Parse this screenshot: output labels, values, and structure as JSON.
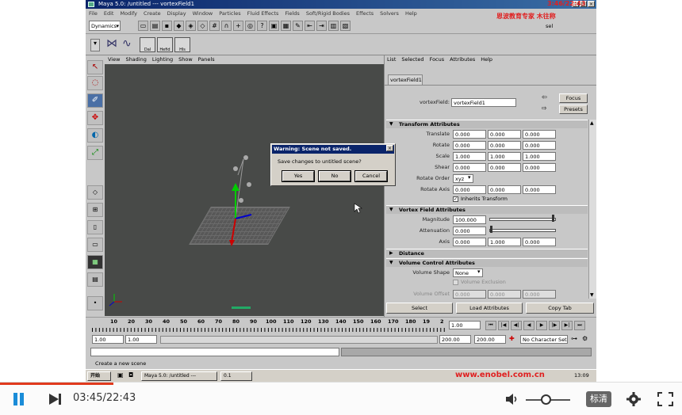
{
  "window": {
    "title": "Maya 5.0: /untitled  ---  vortexField1",
    "controls": [
      "_",
      "□",
      "×"
    ]
  },
  "overlay": {
    "time": "3:46/22:43",
    "brand": "恩波教育专家 木往称",
    "site": "www.enobel.com.cn"
  },
  "menubar": [
    "File",
    "Edit",
    "Modify",
    "Create",
    "Display",
    "Window",
    "Particles",
    "Fluid Effects",
    "Fields",
    "Soft/Rigid Bodies",
    "Effects",
    "Solvers",
    "Help"
  ],
  "status": {
    "menu_set": "Dynamics",
    "field_suffix": "sel"
  },
  "shelf": [
    "Dal",
    "Hefid",
    "Hls"
  ],
  "viewport": {
    "menu": [
      "View",
      "Shading",
      "Lighting",
      "Show",
      "Panels"
    ]
  },
  "attribute_editor": {
    "menu": [
      "List",
      "Selected",
      "Focus",
      "Attributes",
      "Help"
    ],
    "tab": "vortexField1",
    "node_label": "vortexField:",
    "node_value": "vortexField1",
    "focus_button": "Focus",
    "presets_button": "Presets",
    "sections": {
      "transform": "Transform Attributes",
      "vortex": "Vortex Field Attributes",
      "distance": "Distance",
      "volume": "Volume Control Attributes"
    },
    "rows": {
      "translate": {
        "label": "Translate",
        "v": [
          "0.000",
          "0.000",
          "0.000"
        ]
      },
      "rotate": {
        "label": "Rotate",
        "v": [
          "0.000",
          "0.000",
          "0.000"
        ]
      },
      "scale": {
        "label": "Scale",
        "v": [
          "1.000",
          "1.000",
          "1.000"
        ]
      },
      "shear": {
        "label": "Shear",
        "v": [
          "0.000",
          "0.000",
          "0.000"
        ]
      },
      "rotate_order": {
        "label": "Rotate Order",
        "v": "xyz"
      },
      "rotate_axis": {
        "label": "Rotate Axis",
        "v": [
          "0.000",
          "0.000",
          "0.000"
        ]
      },
      "inherits": "Inherits Transform",
      "magnitude": {
        "label": "Magnitude",
        "v": "100.000"
      },
      "attenuation": {
        "label": "Attenuation",
        "v": "0.000"
      },
      "axis": {
        "label": "Axis",
        "v": [
          "0.000",
          "1.000",
          "0.000"
        ]
      },
      "volume_shape": {
        "label": "Volume Shape",
        "v": "None"
      },
      "volume_exclusion": "Volume Exclusion",
      "volume_offset": {
        "label": "Volume Offset",
        "v": [
          "0.000",
          "0.000",
          "0.000"
        ]
      }
    },
    "bottom_buttons": {
      "select": "Select",
      "load": "Load Attributes",
      "copy": "Copy Tab"
    }
  },
  "dialog": {
    "title": "Warning: Scene not saved.",
    "message": "Save changes to untitled scene?",
    "yes": "Yes",
    "no": "No",
    "cancel": "Cancel",
    "close": "×"
  },
  "timeline": {
    "ticks": [
      "10",
      "20",
      "30",
      "40",
      "50",
      "60",
      "70",
      "80",
      "90",
      "100",
      "110",
      "120",
      "130",
      "140",
      "150",
      "160",
      "170",
      "180",
      "19",
      "2"
    ],
    "current": "1.00",
    "start": "1.00",
    "start2": "1.00",
    "end": "200.00",
    "end2": "200.00",
    "character": "No Character Set"
  },
  "help_line": "Create a new scene",
  "taskbar": {
    "start": "开始",
    "tasks": [
      "Maya 5.0: /untitled ---",
      "0.1"
    ],
    "clock": "13:09"
  },
  "player": {
    "time": "03:45/22:43",
    "quality": "标清",
    "progress": 0.166,
    "volume": 0.45
  }
}
